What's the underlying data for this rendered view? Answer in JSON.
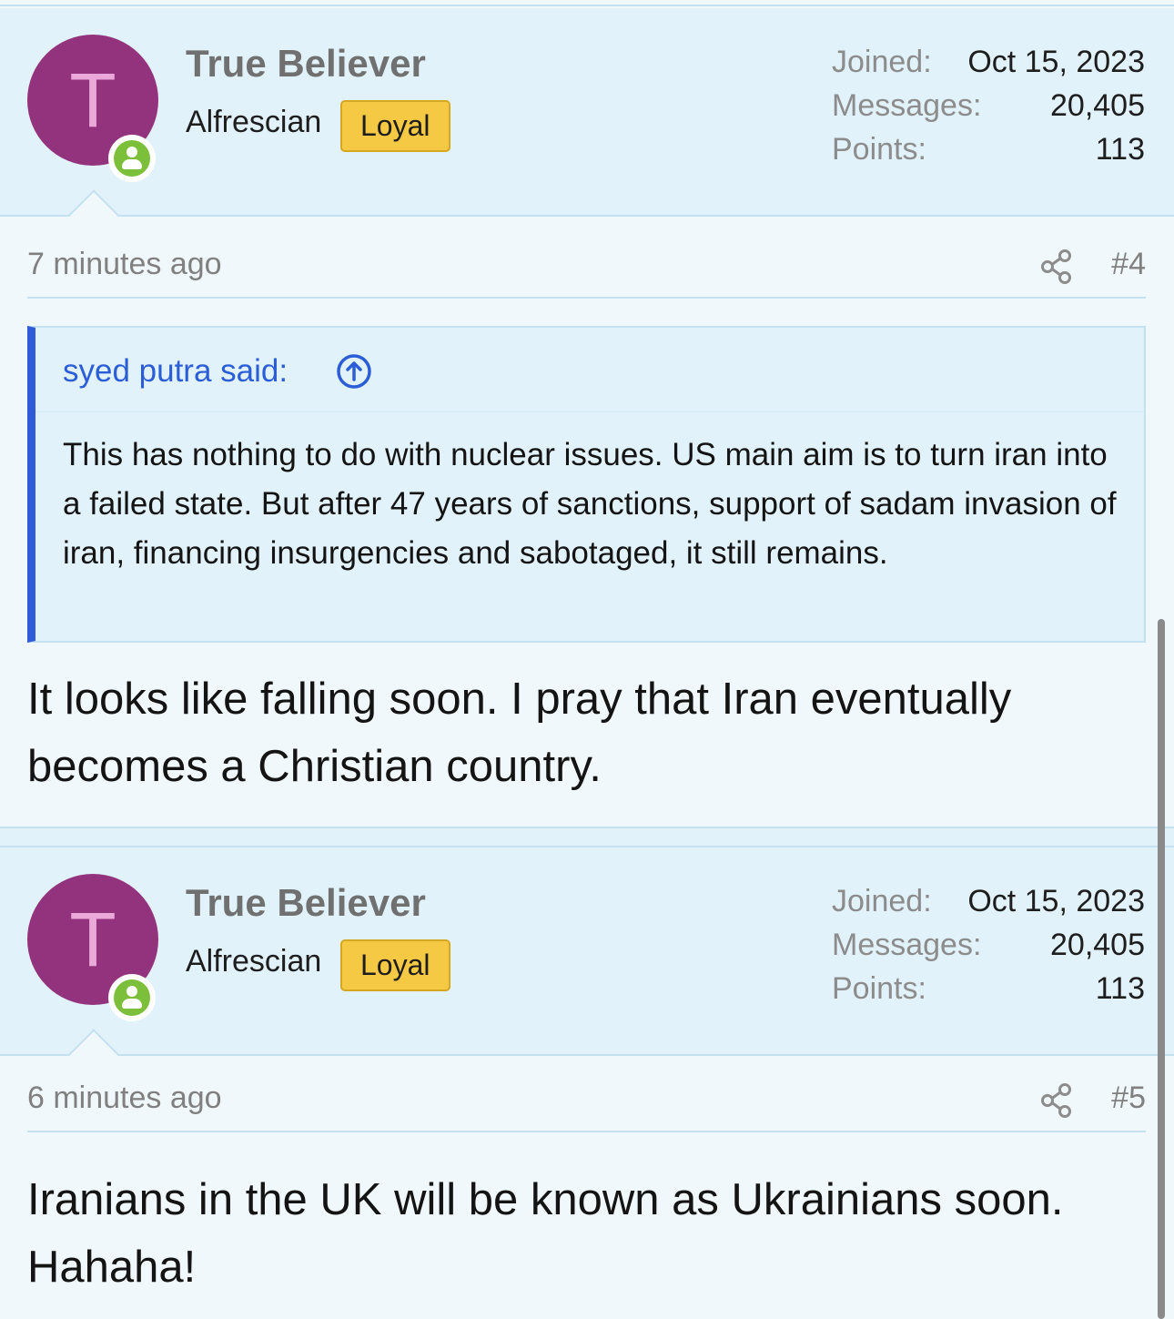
{
  "posts": [
    {
      "avatar_letter": "T",
      "username": "True Believer",
      "user_title": "Alfrescian",
      "badge": "Loyal",
      "stats": {
        "joined_label": "Joined:",
        "joined_value": "Oct 15, 2023",
        "messages_label": "Messages:",
        "messages_value": "20,405",
        "points_label": "Points:",
        "points_value": "113"
      },
      "timestamp": "7 minutes ago",
      "post_number": "#4",
      "quote": {
        "author": "syed putra said:",
        "text": "This has nothing to do with nuclear issues. US main aim is to turn iran into a failed state. But after 47 years of sanctions, support of sadam invasion of iran, financing insurgencies and sabotaged, it still remains."
      },
      "message": "It looks like falling soon. I pray that Iran eventually becomes a Christian country."
    },
    {
      "avatar_letter": "T",
      "username": "True Believer",
      "user_title": "Alfrescian",
      "badge": "Loyal",
      "stats": {
        "joined_label": "Joined:",
        "joined_value": "Oct 15, 2023",
        "messages_label": "Messages:",
        "messages_value": "20,405",
        "points_label": "Points:",
        "points_value": "113"
      },
      "timestamp": "6 minutes ago",
      "post_number": "#5",
      "message": "Iranians in the UK will be known as Ukrainians soon. Hahaha!"
    }
  ],
  "icons": {
    "online": "user-online-icon",
    "share": "share-icon",
    "quote_jump": "arrow-up-circle-icon"
  },
  "colors": {
    "avatar_bg": "#94337d",
    "badge_bg": "#f6c945",
    "online": "#7cbf3a",
    "quote_accent": "#2f5bd8",
    "link": "#2b5ed6",
    "header_bg": "#e1f2fa"
  }
}
